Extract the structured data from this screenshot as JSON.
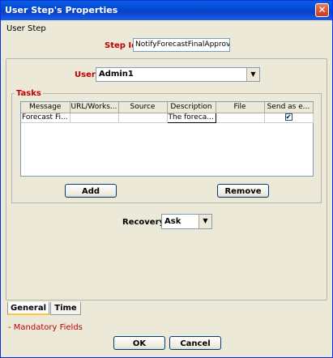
{
  "window": {
    "title": "User Step's Properties",
    "close_glyph": "✕"
  },
  "header": {
    "section_label": "User Step",
    "step_id_label": "Step Id",
    "step_id_value": "NotifyForecastFinalApprove"
  },
  "user": {
    "label": "User:",
    "value": "Admin1",
    "dropdown_glyph": "▼"
  },
  "tasks": {
    "legend": "Tasks",
    "columns": [
      "Message",
      "URL/Works...",
      "Source",
      "Description",
      "File",
      "Send as e..."
    ],
    "rows": [
      {
        "message": "Forecast Fi...",
        "url": "",
        "source": "",
        "description": "The foreca...",
        "file": "",
        "send_as_email": "✔"
      }
    ],
    "add_label": "Add",
    "remove_label": "Remove"
  },
  "recovery": {
    "label": "Recovery:",
    "value": "Ask",
    "dropdown_glyph": "▼"
  },
  "tabs": [
    {
      "label": "General"
    },
    {
      "label": "Time"
    }
  ],
  "footer": {
    "mandatory_note": "- Mandatory Fields",
    "ok_label": "OK",
    "cancel_label": "Cancel"
  },
  "colors": {
    "mandatory": "#c00000",
    "titlebar": "#0a5ddf"
  }
}
